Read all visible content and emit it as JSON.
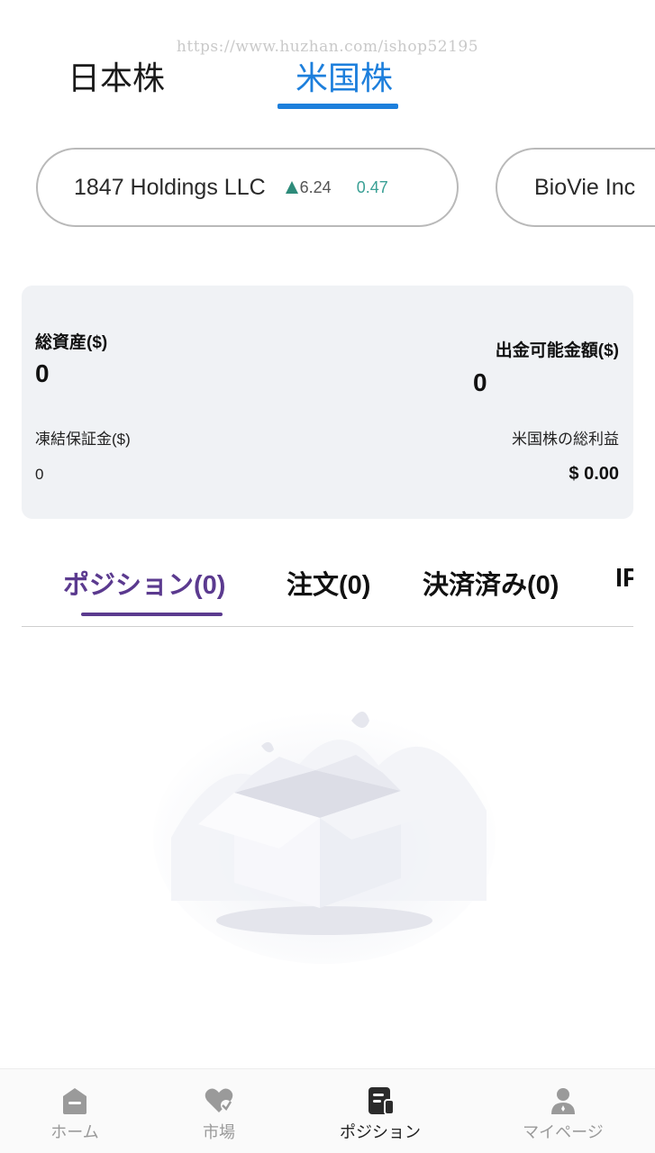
{
  "watermark": "https://www.huzhan.com/ishop52195",
  "market_tabs": [
    {
      "label": "日本株",
      "active": false
    },
    {
      "label": "米国株",
      "active": true
    }
  ],
  "tickers": [
    {
      "name": "1847 Holdings LLC",
      "change": "6.24",
      "percent": "0.47",
      "direction": "up"
    },
    {
      "name": "BioVie Inc"
    }
  ],
  "assets": {
    "total_label": "総資産($)",
    "total_value": "0",
    "withdrawable_label": "出金可能金額($)",
    "withdrawable_value": "0",
    "frozen_label": "凍結保証金($)",
    "frozen_value": "0",
    "profit_label": "米国株の総利益",
    "profit_value": "$ 0.00"
  },
  "order_tabs": [
    {
      "label": "ポジション(0)",
      "active": true
    },
    {
      "label": "注文(0)",
      "active": false
    },
    {
      "label": "決済済み(0)",
      "active": false
    },
    {
      "label": "IPO",
      "active": false
    }
  ],
  "bottom_nav": [
    {
      "label": "ホーム",
      "icon": "home-icon",
      "active": false
    },
    {
      "label": "市場",
      "icon": "market-heart-icon",
      "active": false
    },
    {
      "label": "ポジション",
      "icon": "position-doc-icon",
      "active": true
    },
    {
      "label": "マイページ",
      "icon": "user-icon",
      "active": false
    }
  ],
  "colors": {
    "accent_blue": "#1d7fdc",
    "accent_purple": "#5b3a8f",
    "up_green": "#2e8b7a",
    "card_bg": "#f0f2f5"
  }
}
